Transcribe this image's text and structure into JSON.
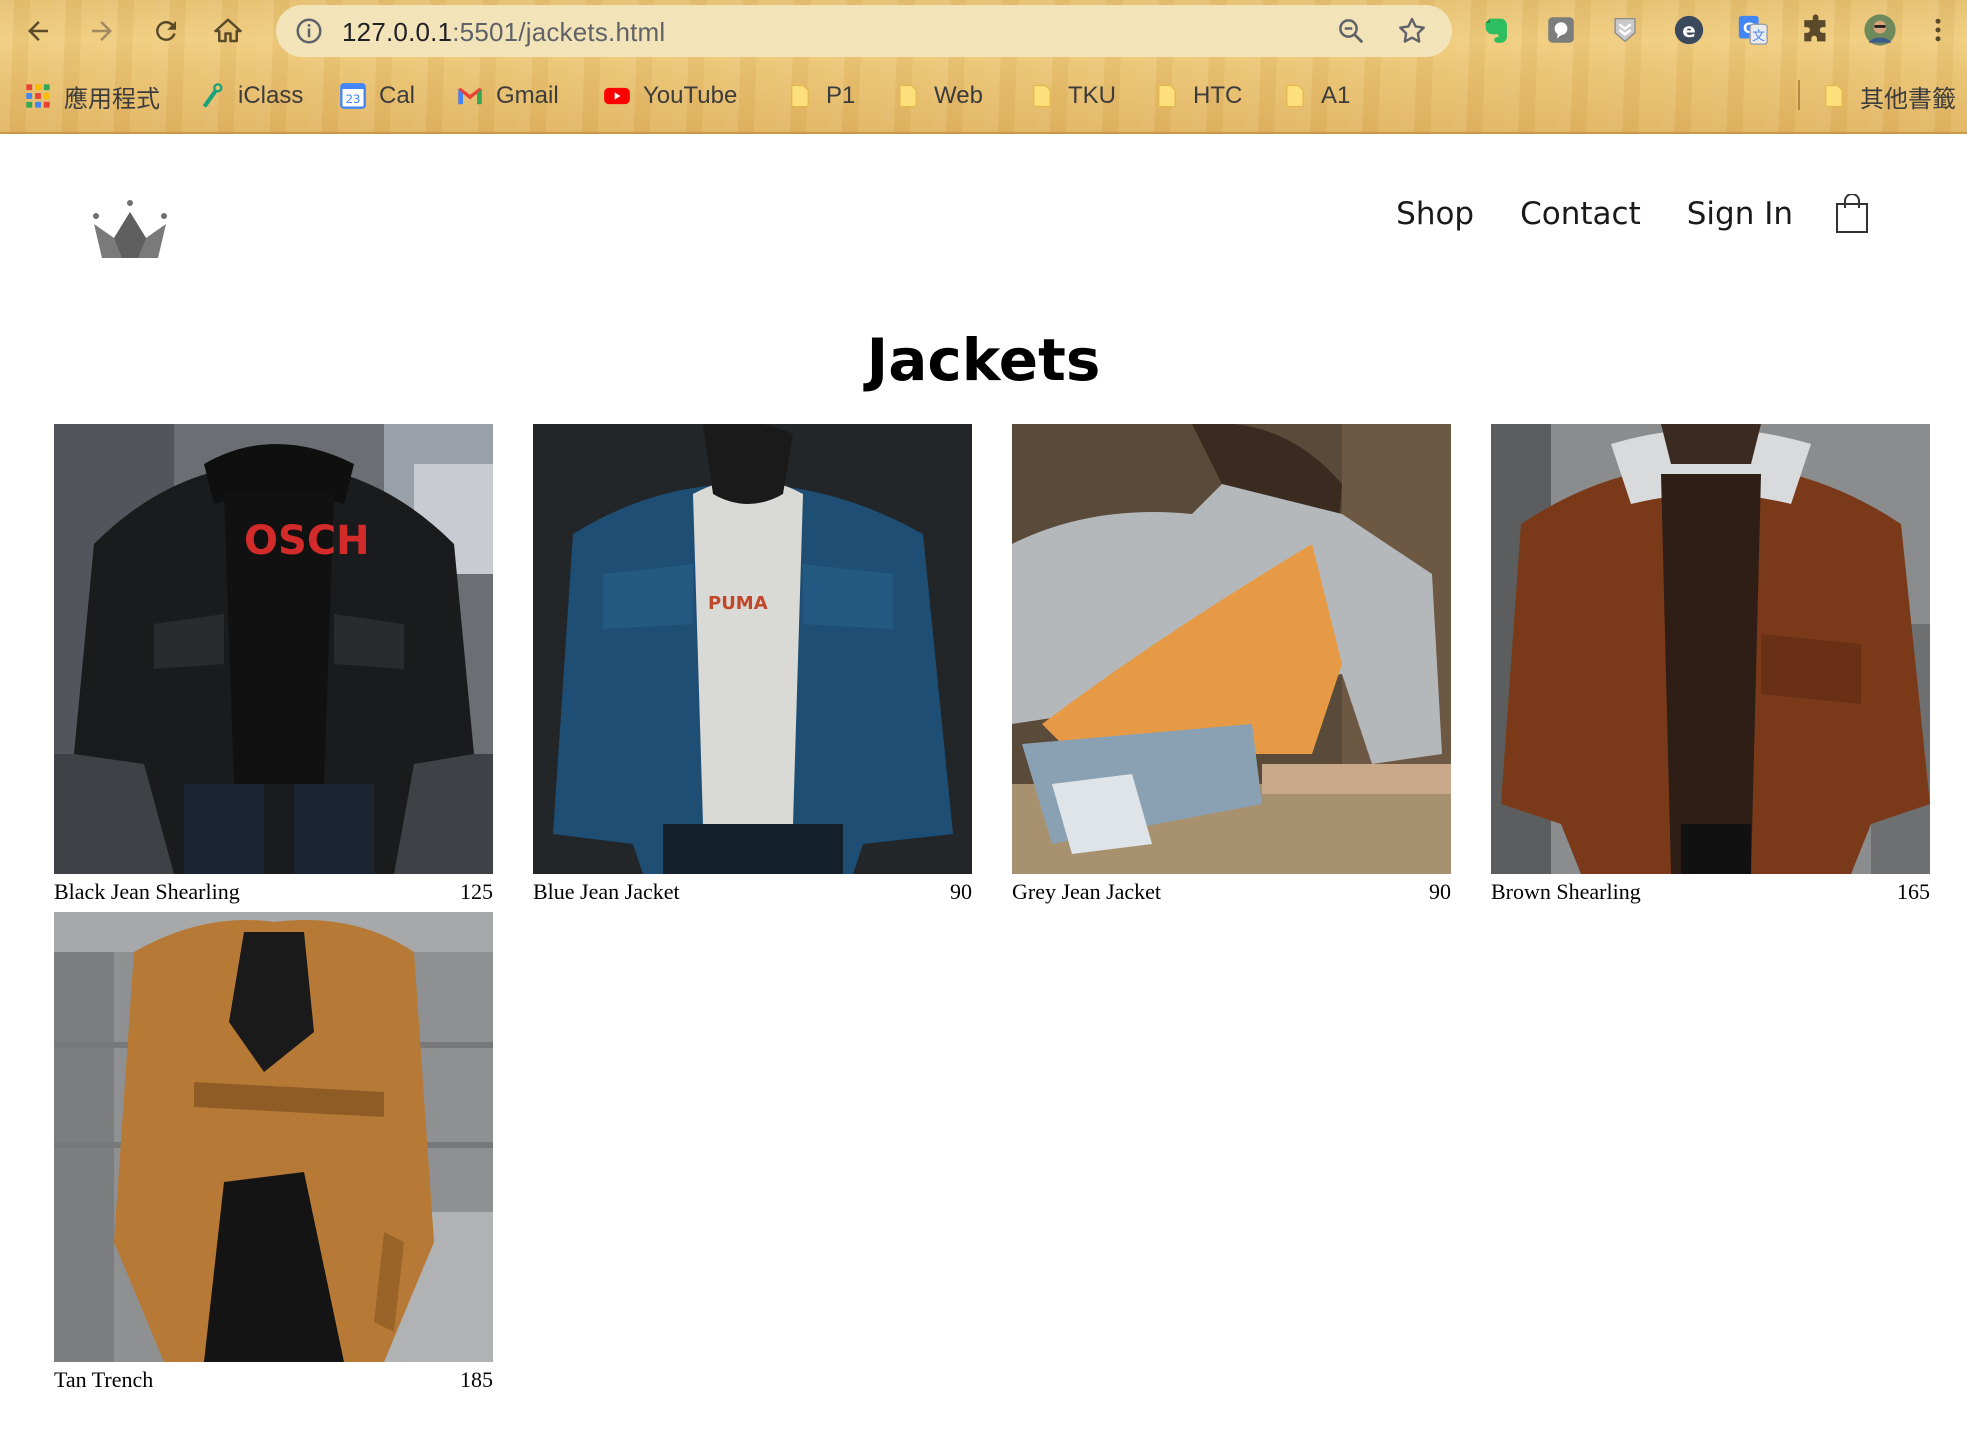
{
  "browser": {
    "url_host": "127.0.0.1",
    "url_path": ":5501/jackets.html",
    "bookmarks": [
      {
        "label": "應用程式",
        "icon": "apps-grid-icon"
      },
      {
        "label": "iClass",
        "icon": "iclass-icon"
      },
      {
        "label": "Cal",
        "icon": "calendar-icon",
        "badge": "23"
      },
      {
        "label": "Gmail",
        "icon": "gmail-icon"
      },
      {
        "label": "YouTube",
        "icon": "youtube-icon"
      },
      {
        "label": "P1",
        "icon": "folder-icon"
      },
      {
        "label": "Web",
        "icon": "folder-icon"
      },
      {
        "label": "TKU",
        "icon": "folder-icon"
      },
      {
        "label": "HTC",
        "icon": "folder-icon"
      },
      {
        "label": "A1",
        "icon": "folder-icon"
      }
    ],
    "other_bookmarks": "其他書籤"
  },
  "site": {
    "nav": {
      "shop": "Shop",
      "contact": "Contact",
      "sign_in": "Sign In"
    },
    "page_title": "Jackets"
  },
  "products": [
    {
      "name": "Black Jean Shearling",
      "price": "125"
    },
    {
      "name": "Blue Jean Jacket",
      "price": "90"
    },
    {
      "name": "Grey Jean Jacket",
      "price": "90"
    },
    {
      "name": "Brown Shearling",
      "price": "165"
    },
    {
      "name": "Tan Trench",
      "price": "185"
    }
  ],
  "colors": {
    "chrome_wood": "#e9c172",
    "omnibox": "#f3e3b8",
    "logo_grey": "#6f6f6f"
  }
}
